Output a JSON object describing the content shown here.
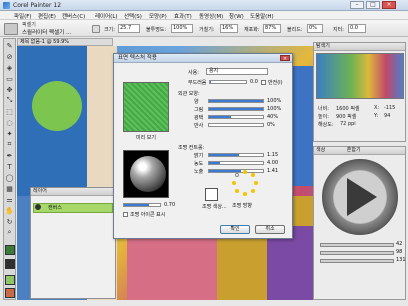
{
  "app": {
    "title": "Corel Painter 12"
  },
  "menu": [
    "파일(F)",
    "편집(E)",
    "캔버스(C)",
    "레이어(L)",
    "선택(S)",
    "모양(P)",
    "효과(T)",
    "동영상(M)",
    "창(W)",
    "도움말(H)"
  ],
  "property_bar": {
    "brush_category": "픽셀기",
    "brush_variant": "스월러이터 펙셀기 ...",
    "size_label": "크기:",
    "size_value": "25.7",
    "opacity_label": "불투명도:",
    "opacity_value": "100%",
    "grain_label": "거칠기:",
    "grain_value": "16%",
    "resat_label": "재포화:",
    "resat_value": "87%",
    "bleed_label": "블리드:",
    "bleed_value": "0%",
    "jitter_label": "지터:",
    "jitter_value": "0.0"
  },
  "document": {
    "tab_title": "제목 없음-1 @ 59.9%"
  },
  "layers": {
    "panel_title": "레이어",
    "layer_name": "캔버스"
  },
  "navigator": {
    "title": "탐색기",
    "x_label": "X:",
    "x_value": "-115",
    "y_label": "Y:",
    "y_value": "94",
    "width_label": "너비:",
    "width_value": "1600 픽셀",
    "height_label": "높이:",
    "height_value": "900 픽셀",
    "resolution_label": "해상도:",
    "resolution_value": "72 ppi"
  },
  "color_panel": {
    "title": "색상",
    "tab2": "혼합기",
    "slider_values": [
      "42",
      "98",
      "131"
    ]
  },
  "dialog": {
    "title": "표면 텍스처 적용",
    "using_label": "사용:",
    "using_value": "용지",
    "smooth_label": "부드러움",
    "smooth_value": "0.0",
    "invert_label": "반전(I)",
    "preview_label": "미리 보기",
    "appearance_label": "외관 모양:",
    "amount_label": "양",
    "amount_value": "100%",
    "picture_label": "그림",
    "picture_value": "100%",
    "shine_label": "광택",
    "shine_value": "40%",
    "reflection_label": "반사",
    "reflection_value": "0%",
    "light_label": "조명 컨트롤:",
    "brightness_label": "밝기",
    "brightness_value": "1.15",
    "conc_label": "농도",
    "conc_value": "4.00",
    "exposure_label": "노출",
    "exposure_value": "1.41",
    "ball_value": "0.70",
    "show_light_label": "조명 아이콘 표시",
    "light_color_label": "조명 색상...",
    "light_dir_label": "조명 방향",
    "ok": "확인",
    "cancel": "취소"
  },
  "colors": {
    "accent": "#3a7bd5",
    "layer_selected": "#a7d86a"
  }
}
